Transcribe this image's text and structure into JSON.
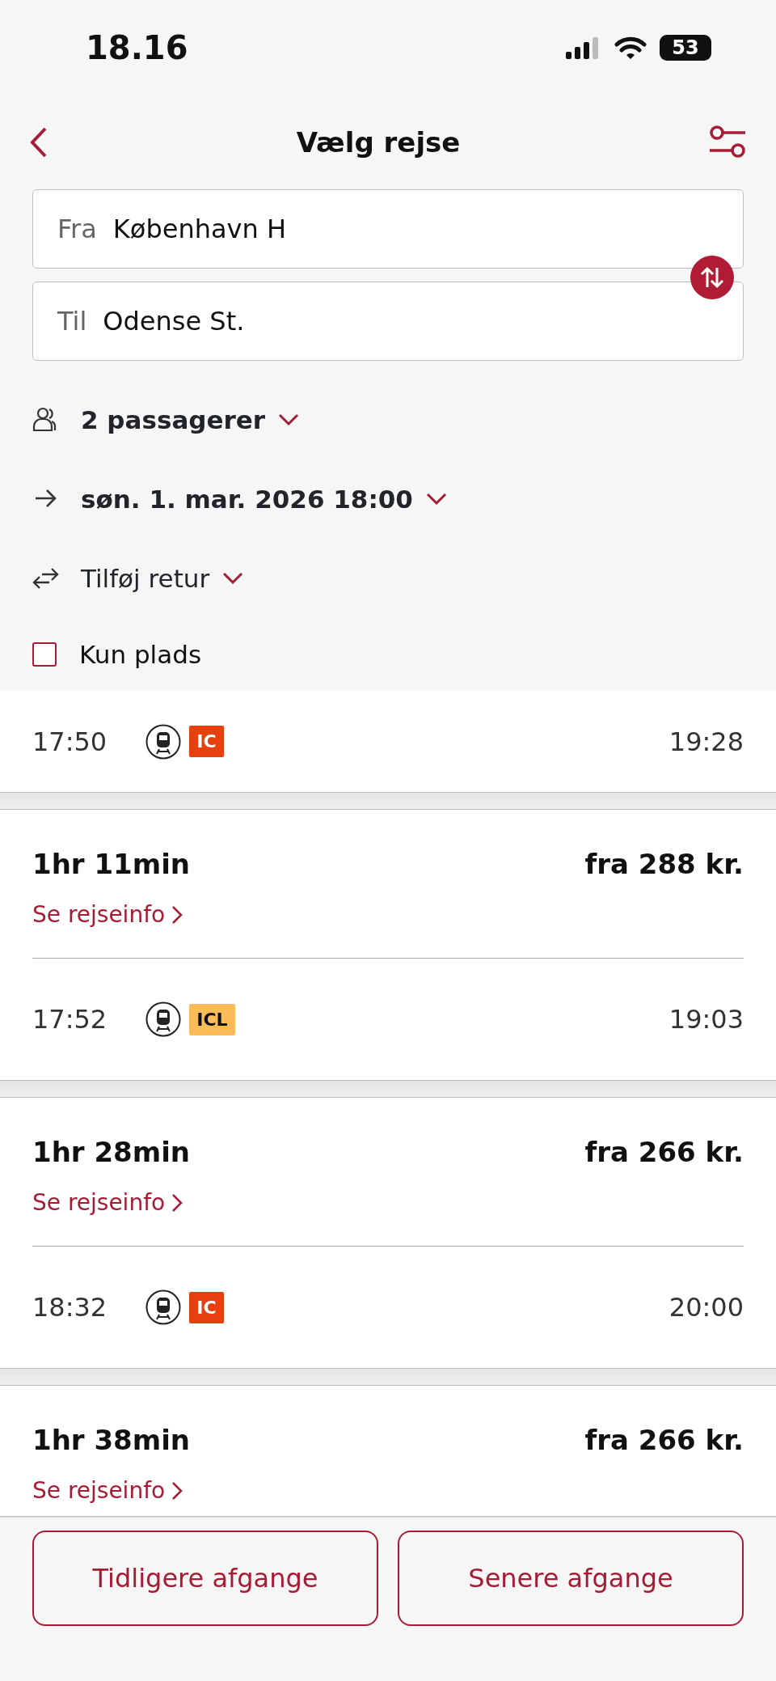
{
  "status_bar": {
    "time": "18.16",
    "battery": "53"
  },
  "header": {
    "title": "Vælg rejse"
  },
  "route": [
    {
      "label": "Fra",
      "value": "København H"
    },
    {
      "label": "Til",
      "value": "Odense St."
    }
  ],
  "options": [
    {
      "kind": "passengers",
      "text": "2 passagerer",
      "bold": true
    },
    {
      "kind": "date",
      "text": "søn. 1. mar. 2026 18:00",
      "bold": true
    },
    {
      "kind": "return",
      "text": "Tilføj retur",
      "bold": false
    }
  ],
  "only_seats": {
    "label": "Kun plads",
    "checked": false
  },
  "journeys": [
    {
      "legs": [
        {
          "departure": "17:50",
          "product": "IC",
          "color": "#e5400d",
          "arrival": "19:28"
        }
      ]
    },
    {
      "duration": "1hr 11min",
      "price": "fra 288 kr.",
      "link": "Se rejseinfo",
      "legs": [
        {
          "departure": "17:52",
          "product": "ICL",
          "color": "#fbbb58",
          "arrival": "19:03"
        }
      ]
    },
    {
      "duration": "1hr 28min",
      "price": "fra 266 kr.",
      "link": "Se rejseinfo",
      "legs": [
        {
          "departure": "18:32",
          "product": "IC",
          "color": "#e5400d",
          "arrival": "20:00"
        }
      ]
    },
    {
      "duration": "1hr 38min",
      "price": "fra 266 kr.",
      "link": "Se rejseinfo"
    }
  ],
  "buttons": [
    "Tidligere afgange",
    "Senere afgange"
  ]
}
